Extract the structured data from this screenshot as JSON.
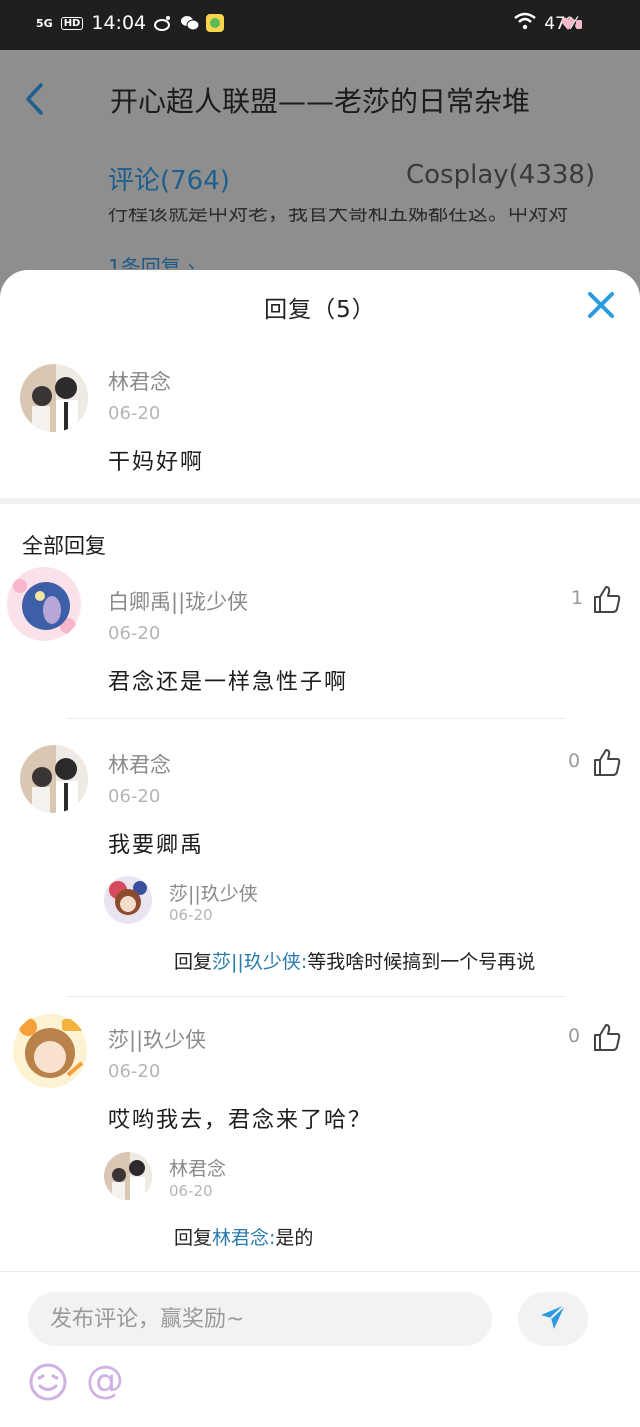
{
  "status_bar": {
    "network": "5G",
    "hd": "HD",
    "time": "14:04",
    "battery": "47%"
  },
  "page": {
    "title": "开心超人联盟——老莎的日常杂堆",
    "tabs": [
      {
        "label": "评论(764)"
      },
      {
        "label": "Cosplay(4338)"
      }
    ],
    "peek_text": "行程该就是中对老，我官大哥和五姊都在这。中对对",
    "peek_link": "1条回复 ›"
  },
  "sheet": {
    "title": "回复（5）",
    "main_comment": {
      "user": "林君念",
      "date": "06-20",
      "text": "干妈好啊"
    },
    "section_label": "全部回复",
    "replies": [
      {
        "user": "白卿禹||珑少侠",
        "date": "06-20",
        "text": "君念还是一样急性子啊",
        "likes": "1"
      },
      {
        "user": "林君念",
        "date": "06-20",
        "text": "我要卿禹",
        "likes": "0",
        "sub": {
          "user": "莎||玖少侠",
          "date": "06-20",
          "prefix": "回复",
          "mention": "莎||玖少侠:",
          "text": "等我啥时候搞到一个号再说"
        }
      },
      {
        "user": "莎||玖少侠",
        "date": "06-20",
        "text": "哎哟我去，君念来了哈？",
        "likes": "0",
        "sub": {
          "user": "林君念",
          "date": "06-20",
          "prefix": "回复",
          "mention": "林君念:",
          "text": "是的"
        }
      }
    ]
  },
  "composer": {
    "placeholder": "发布评论，赢奖励~",
    "at_symbol": "@"
  },
  "colors": {
    "accent": "#2a9be0",
    "mention": "#2a7cb0",
    "tab_active": "#1e5f8e"
  }
}
